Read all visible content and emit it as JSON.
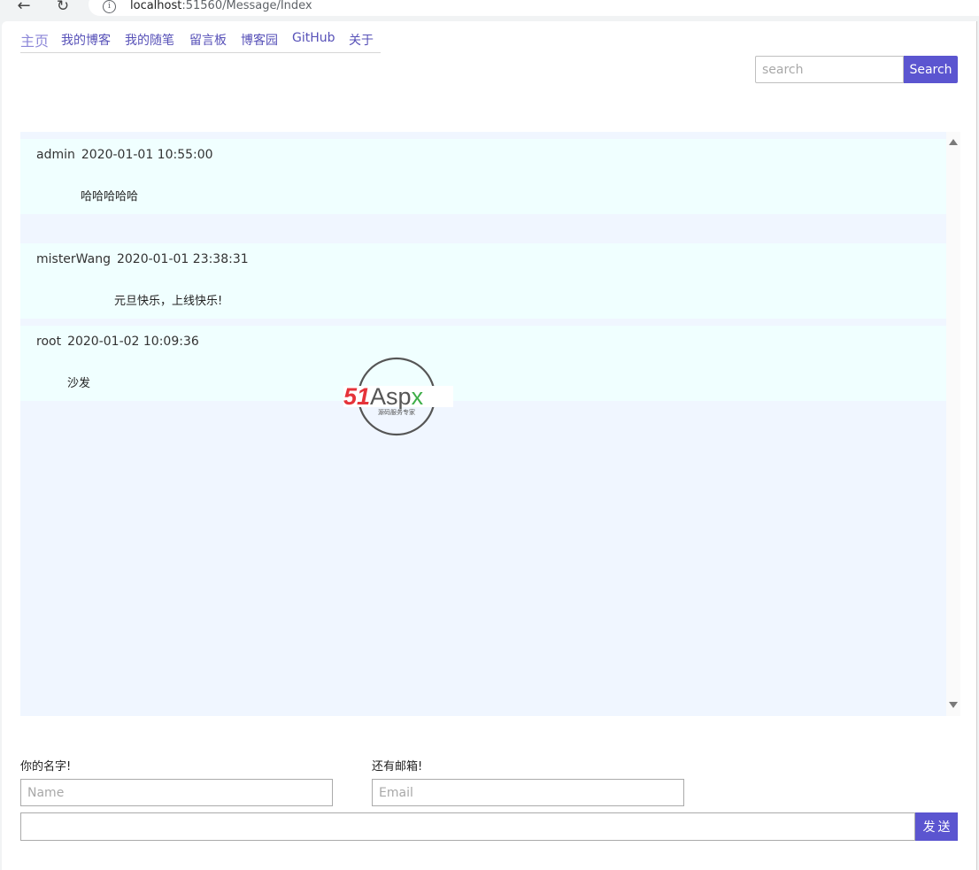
{
  "browser": {
    "url_host": "localhost",
    "url_rest": ":51560/Message/Index",
    "back_glyph": "←",
    "reload_glyph": "↻",
    "info_glyph": "i"
  },
  "nav": {
    "items": [
      {
        "label": "主页",
        "active": true
      },
      {
        "label": "我的博客"
      },
      {
        "label": "我的随笔"
      },
      {
        "label": "留言板"
      },
      {
        "label": "博客园"
      },
      {
        "label": "GitHub"
      },
      {
        "label": "关于"
      }
    ]
  },
  "search": {
    "placeholder": "search",
    "button_label": "Search"
  },
  "messages": [
    {
      "author": "admin",
      "time": "2020-01-01 10:55:00",
      "content": "哈哈哈哈哈"
    },
    {
      "author": "misterWang",
      "time": "2020-01-01 23:38:31",
      "content": "元旦快乐，上线快乐!"
    },
    {
      "author": "root",
      "time": "2020-01-02 10:09:36",
      "content": "沙发"
    }
  ],
  "watermark": {
    "brand_red": "51",
    "brand_gray": "Asp",
    "brand_green": "x",
    "tagline": "源码服务专家",
    "colors": {
      "red": "#e5333a",
      "gray": "#555555",
      "green": "#3fae49"
    }
  },
  "form": {
    "name_label": "你的名字!",
    "name_placeholder": "Name",
    "email_label": "还有邮箱!",
    "email_placeholder": "Email",
    "message_value": "",
    "send_label": "发送"
  },
  "colors": {
    "accent": "#5b55d0",
    "nav_link": "#5751b8",
    "panel_bg": "#f0f6ff",
    "message_bg": "#f0ffff"
  }
}
